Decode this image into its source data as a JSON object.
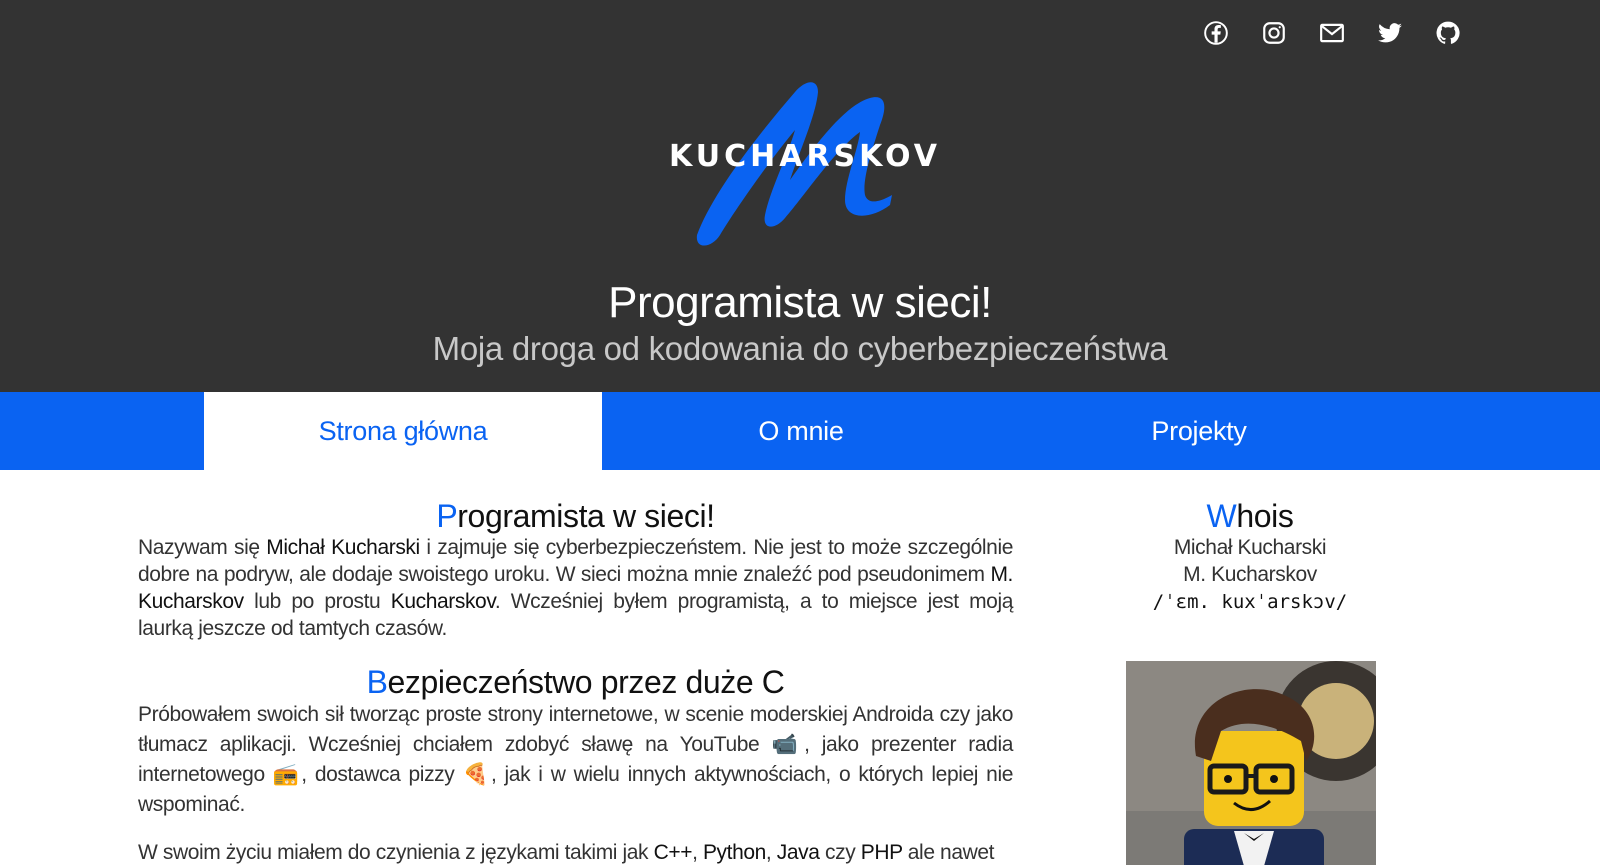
{
  "socials": [
    {
      "name": "facebook-icon"
    },
    {
      "name": "instagram-icon"
    },
    {
      "name": "email-icon"
    },
    {
      "name": "twitter-icon"
    },
    {
      "name": "github-icon"
    }
  ],
  "logo": {
    "text": "KUCHARSKOV",
    "letter": "M"
  },
  "hero": {
    "title": "Programista w sieci!",
    "subtitle": "Moja droga od kodowania do cyberbezpieczeństwa"
  },
  "nav": {
    "tabs": [
      {
        "label": "Strona główna",
        "active": true
      },
      {
        "label": "O mnie",
        "active": false
      },
      {
        "label": "Projekty",
        "active": false
      }
    ]
  },
  "colors": {
    "accent": "#0a63f2",
    "header_bg": "#333333"
  },
  "main": {
    "section1": {
      "title_cap": "P",
      "title_rest": "rogramista w sieci!",
      "p": {
        "a": "Nazywam się ",
        "b": "Michał Kucharski",
        "c": " i zajmuje się cyberbezpieczeństem. Nie jest to może szczególnie dobre na podryw, ale dodaje swoistego uroku. W sieci można mnie znaleźć pod pseudonimem ",
        "d": "M. Kucharskov",
        "e": " lub po prostu ",
        "f": "Kucharskov",
        "g": ". Wcześniej byłem programistą, a to miejsce jest moją laurką jeszcze od tamtych czasów."
      }
    },
    "section2": {
      "title_cap": "B",
      "title_rest": "ezpieczeństwo przez duże C",
      "p1": "Próbowałem swoich sił tworząc proste strony internetowe, w scenie moderskiej Androida czy jako tłumacz aplikacji. Wcześniej chciałem zdobyć sławę na YouTube 📹, jako prezenter radia internetowego 📻, dostawca pizzy 🍕, jak i w wielu innych aktywnościach, o których lepiej nie wspominać.",
      "p2": {
        "a": "W swoim życiu miałem do czynienia z językami takimi jak ",
        "b": "C++",
        "c": ", ",
        "d": "Python",
        "e": ", ",
        "f": "Java",
        "g": " czy ",
        "h": "PHP",
        "i": " ale nawet"
      }
    }
  },
  "sidebar": {
    "title_cap": "W",
    "title_rest": "hois",
    "name": "Michał Kucharski",
    "alias": "M. Kucharskov",
    "ipa": "/ˈɛm. kuxˈarskɔv/"
  }
}
